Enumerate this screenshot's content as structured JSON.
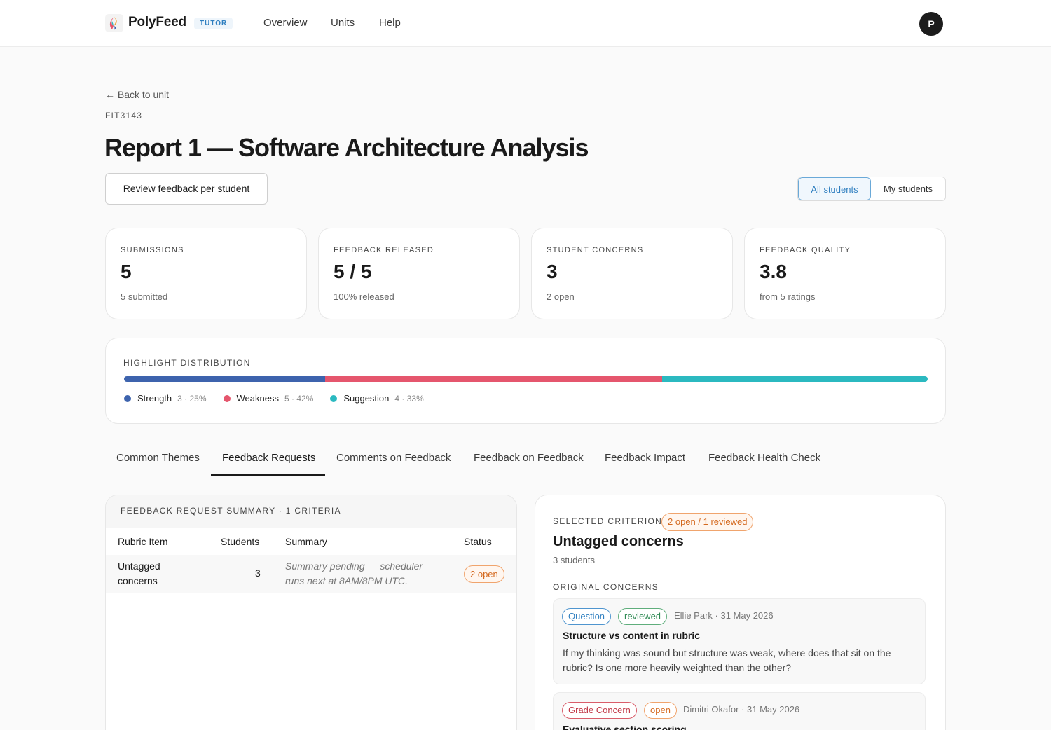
{
  "header": {
    "brand": "PolyFeed",
    "role_badge": "TUTOR",
    "nav": [
      "Overview",
      "Units",
      "Help"
    ],
    "avatar_initial": "P"
  },
  "page": {
    "back_label": "← Back to unit",
    "unit_code": "FIT3143",
    "title": "Report 1 — Software Architecture Analysis",
    "review_button": "Review feedback per student",
    "filter": {
      "all": "All students",
      "mine": "My students",
      "selected": "All students"
    }
  },
  "stats": [
    {
      "label": "SUBMISSIONS",
      "value": "5",
      "sub": "5 submitted"
    },
    {
      "label": "FEEDBACK RELEASED",
      "value": "5 / 5",
      "sub": "100% released"
    },
    {
      "label": "STUDENT CONCERNS",
      "value": "3",
      "sub": "2 open"
    },
    {
      "label": "FEEDBACK QUALITY",
      "value": "3.8",
      "sub": "from 5 ratings"
    }
  ],
  "distribution": {
    "label": "HIGHLIGHT DISTRIBUTION",
    "segments": [
      {
        "name": "Strength",
        "stat": "3 · 25%",
        "percent": 25,
        "color": "#3d63ad"
      },
      {
        "name": "Weakness",
        "stat": "5 · 42%",
        "percent": 42,
        "color": "#e5566d"
      },
      {
        "name": "Suggestion",
        "stat": "4 · 33%",
        "percent": 33,
        "color": "#2bb9c0"
      }
    ]
  },
  "tabs": [
    "Common Themes",
    "Feedback Requests",
    "Comments on Feedback",
    "Feedback on Feedback",
    "Feedback Impact",
    "Feedback Health Check"
  ],
  "active_tab": "Feedback Requests",
  "summary": {
    "heading": "FEEDBACK REQUEST SUMMARY · 1 CRITERIA",
    "columns": [
      "Rubric Item",
      "Students",
      "Summary",
      "Status"
    ],
    "rows": [
      {
        "rubric_line1": "Untagged",
        "rubric_line2": "concerns",
        "students": "3",
        "summary_line1": "Summary pending — scheduler",
        "summary_line2": "runs next at 8AM/8PM UTC.",
        "status": "2 open"
      }
    ]
  },
  "selected": {
    "label": "SELECTED CRITERION",
    "pill": "2 open / 1 reviewed",
    "title": "Untagged concerns",
    "sub": "3 students",
    "section": "ORIGINAL CONCERNS",
    "concerns": [
      {
        "type": "Question",
        "state": "reviewed",
        "meta": "Ellie Park · 31 May 2026",
        "title": "Structure vs content in rubric",
        "body": "If my thinking was sound but structure was weak, where does that sit on the rubric? Is one more heavily weighted than the other?"
      },
      {
        "type": "Grade Concern",
        "state": "open",
        "meta": "Dimitri Okafor · 31 May 2026",
        "title": "Evaluative section scoring",
        "body": ""
      }
    ]
  }
}
